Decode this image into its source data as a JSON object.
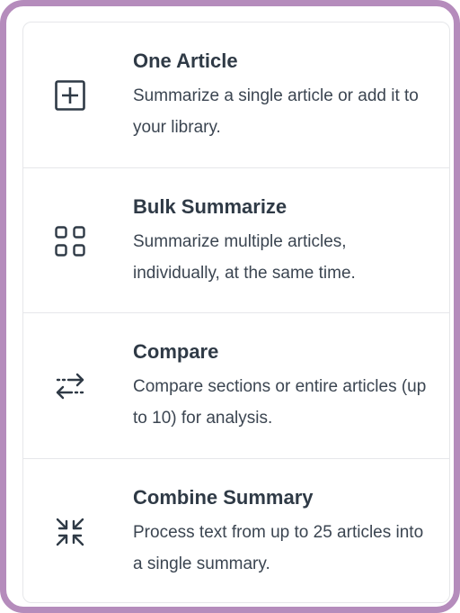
{
  "options": [
    {
      "title": "One Article",
      "description": "Summarize a single article or add it to your library.",
      "icon": "plus-square-icon"
    },
    {
      "title": "Bulk Summarize",
      "description": "Summarize multiple articles, individually, at the same time.",
      "icon": "grid-icon"
    },
    {
      "title": "Compare",
      "description": "Compare sections or entire articles (up to 10) for analysis.",
      "icon": "compare-arrows-icon"
    },
    {
      "title": "Combine Summary",
      "description": "Process text from up to 25 articles into a single summary.",
      "icon": "combine-arrows-icon"
    }
  ],
  "colors": {
    "frame": "#b58cbc",
    "text": "#2f3a46",
    "border": "#e6e7ea"
  }
}
